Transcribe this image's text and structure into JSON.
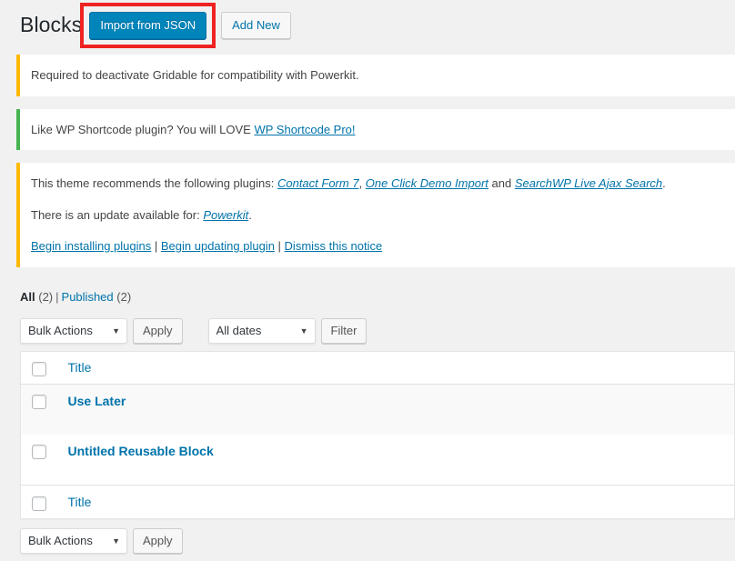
{
  "header": {
    "title": "Blocks",
    "import_button": "Import from JSON",
    "add_new_button": "Add New"
  },
  "notices": [
    {
      "type": "warning",
      "accent": "#ffb900",
      "text": "Required to deactivate Gridable for compatibility with Powerkit."
    },
    {
      "type": "success",
      "accent": "#46b450",
      "lead": "Like WP Shortcode plugin? You will LOVE ",
      "link": "WP Shortcode Pro!"
    },
    {
      "type": "warning",
      "accent": "#ffb900",
      "line1_lead": "This theme recommends the following plugins: ",
      "line1_link1": "Contact Form 7",
      "line1_sep1": ", ",
      "line1_link2": "One Click Demo Import",
      "line1_sep2": " and ",
      "line1_link3": "SearchWP Live Ajax Search",
      "line1_tail": ".",
      "line2_lead": "There is an update available for: ",
      "line2_link": "Powerkit",
      "line2_tail": ".",
      "action1": "Begin installing plugins",
      "action2": "Begin updating plugin",
      "action3": "Dismiss this notice",
      "action_sep": "|"
    }
  ],
  "filters": {
    "all_label": "All",
    "all_count": "(2)",
    "divider": "|",
    "published_label": "Published",
    "published_count": "(2)"
  },
  "tablenav_top": {
    "bulk_actions": "Bulk Actions",
    "apply": "Apply",
    "dates": "All dates",
    "filter": "Filter",
    "caret": "▼"
  },
  "tablenav_bottom": {
    "bulk_actions": "Bulk Actions",
    "apply": "Apply",
    "caret": "▼"
  },
  "table": {
    "column_title": "Title",
    "footer_title": "Title",
    "rows": [
      {
        "title": "Use Later"
      },
      {
        "title": "Untitled Reusable Block"
      }
    ]
  }
}
